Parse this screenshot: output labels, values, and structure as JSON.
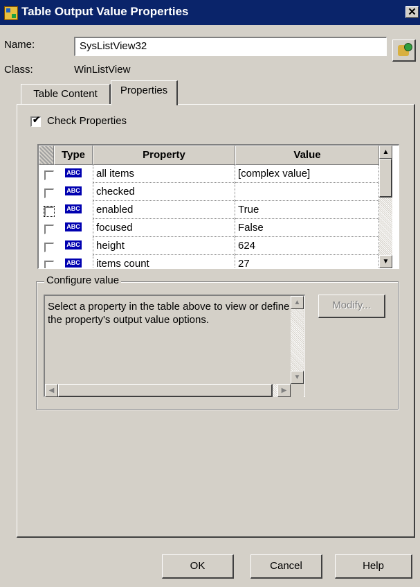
{
  "window": {
    "title": "Table Output Value Properties",
    "close_glyph": "✕"
  },
  "name": {
    "label": "Name:",
    "value": "SysListView32"
  },
  "class": {
    "label": "Class:",
    "value": "WinListView"
  },
  "tabs": [
    {
      "label": "Table Content",
      "active": false
    },
    {
      "label": "Properties",
      "active": true
    }
  ],
  "check_properties": {
    "label": "Check Properties",
    "checked": true
  },
  "grid": {
    "columns": {
      "type": "Type",
      "property": "Property",
      "value": "Value"
    },
    "type_badge": "ABC",
    "rows": [
      {
        "property": "all items",
        "value": "[complex value]",
        "checked": false
      },
      {
        "property": "checked",
        "value": "",
        "checked": false
      },
      {
        "property": "enabled",
        "value": "True",
        "checked": false
      },
      {
        "property": "focused",
        "value": "False",
        "checked": false
      },
      {
        "property": "height",
        "value": "624",
        "checked": false
      },
      {
        "property": "items count",
        "value": "27",
        "checked": false
      }
    ]
  },
  "configure_value": {
    "legend": "Configure value",
    "description": "Select a property in the table above to view or define the property's output value options.",
    "modify_label": "Modify..."
  },
  "buttons": {
    "ok": "OK",
    "cancel": "Cancel",
    "help": "Help"
  },
  "icons": {
    "app": "table-output-icon",
    "finder": "object-finder-icon",
    "scroll_up": "▲",
    "scroll_down": "▼",
    "scroll_left": "◀",
    "scroll_right": "▶"
  }
}
